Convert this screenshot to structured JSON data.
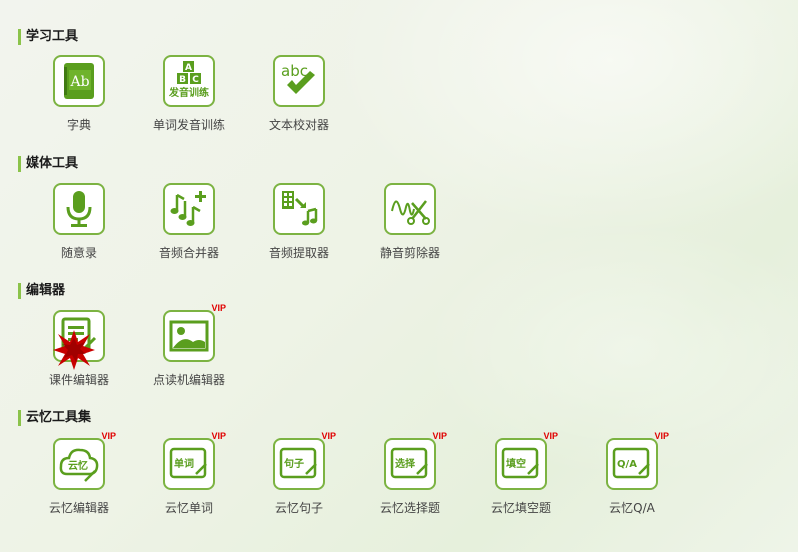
{
  "sections": [
    {
      "title": "学习工具",
      "tools": [
        {
          "label": "字典",
          "icon": "dictionary-icon"
        },
        {
          "label": "单词发音训练",
          "icon": "abc-pronunciation-icon",
          "icon_text": "发音训练"
        },
        {
          "label": "文本校对器",
          "icon": "abc-check-icon",
          "icon_text": "abc"
        }
      ]
    },
    {
      "title": "媒体工具",
      "tools": [
        {
          "label": "随意录",
          "icon": "microphone-icon"
        },
        {
          "label": "音频合并器",
          "icon": "music-merge-icon"
        },
        {
          "label": "音频提取器",
          "icon": "audio-extract-icon"
        },
        {
          "label": "静音剪除器",
          "icon": "waveform-scissors-icon"
        }
      ]
    },
    {
      "title": "编辑器",
      "tools": [
        {
          "label": "课件编辑器",
          "icon": "document-edit-icon"
        },
        {
          "label": "点读机编辑器",
          "icon": "picture-icon",
          "badge": "VIP"
        }
      ]
    },
    {
      "title": "云忆工具集",
      "tools": [
        {
          "label": "云忆编辑器",
          "icon": "cloud-edit-icon",
          "badge": "VIP",
          "icon_text": "云忆"
        },
        {
          "label": "云忆单词",
          "icon": "word-edit-icon",
          "badge": "VIP",
          "icon_text": "单词"
        },
        {
          "label": "云忆句子",
          "icon": "sentence-edit-icon",
          "badge": "VIP",
          "icon_text": "句子"
        },
        {
          "label": "云忆选择题",
          "icon": "choice-edit-icon",
          "badge": "VIP",
          "icon_text": "选择"
        },
        {
          "label": "云忆填空题",
          "icon": "fill-blank-edit-icon",
          "badge": "VIP",
          "icon_text": "填空"
        },
        {
          "label": "云忆Q/A",
          "icon": "qa-edit-icon",
          "badge": "VIP",
          "icon_text": "Q/A"
        }
      ]
    }
  ],
  "colors": {
    "accent": "#7cb342",
    "icon_green": "#5a9e1e",
    "vip": "#e00000"
  }
}
